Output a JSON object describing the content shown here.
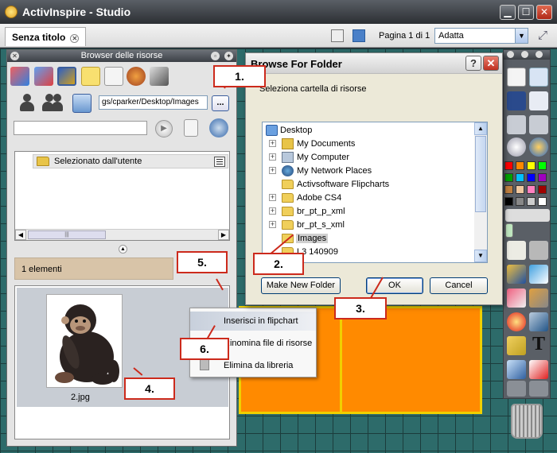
{
  "window": {
    "title": "ActivInspire - Studio"
  },
  "tabbar": {
    "tab_label": "Senza titolo",
    "page_label": "Pagina 1 di 1",
    "zoom_value": "Adatta"
  },
  "resource_browser": {
    "title": "Browser delle risorse",
    "path": "gs/cparker/Desktop/Images",
    "browse_label": "...",
    "tree_item": "Selezionato dall'utente",
    "count": "1 elementi",
    "thumbnail_caption": "2.jpg"
  },
  "context_menu": {
    "items": [
      "Inserisci in flipchart",
      "Rinomina file di risorse",
      "Elimina da libreria"
    ]
  },
  "dialog": {
    "title": "Browse For Folder",
    "prompt": "Seleziona cartella di risorse",
    "tree": [
      {
        "label": "Desktop",
        "icon": "desktop-icon"
      },
      {
        "label": "My Documents",
        "icon": "documents-icon"
      },
      {
        "label": "My Computer",
        "icon": "computer-icon"
      },
      {
        "label": "My Network Places",
        "icon": "network-icon"
      },
      {
        "label": "Activsoftware Flipcharts",
        "icon": "folder-icon"
      },
      {
        "label": "Adobe CS4",
        "icon": "folder-icon"
      },
      {
        "label": "br_pt_p_xml",
        "icon": "folder-icon"
      },
      {
        "label": "br_pt_s_xml",
        "icon": "folder-icon"
      },
      {
        "label": "Images",
        "icon": "folder-icon"
      },
      {
        "label": "L3 140909",
        "icon": "folder-icon"
      }
    ],
    "new_folder_label": "Make New Folder",
    "ok_label": "OK",
    "cancel_label": "Cancel"
  },
  "callouts": [
    "1.",
    "2.",
    "3.",
    "4.",
    "5.",
    "6."
  ],
  "colors": {
    "callout_red": "#cc2a1c",
    "canvas_teal": "#2d6b6a",
    "flipchart_orange": "#ff8a00"
  }
}
